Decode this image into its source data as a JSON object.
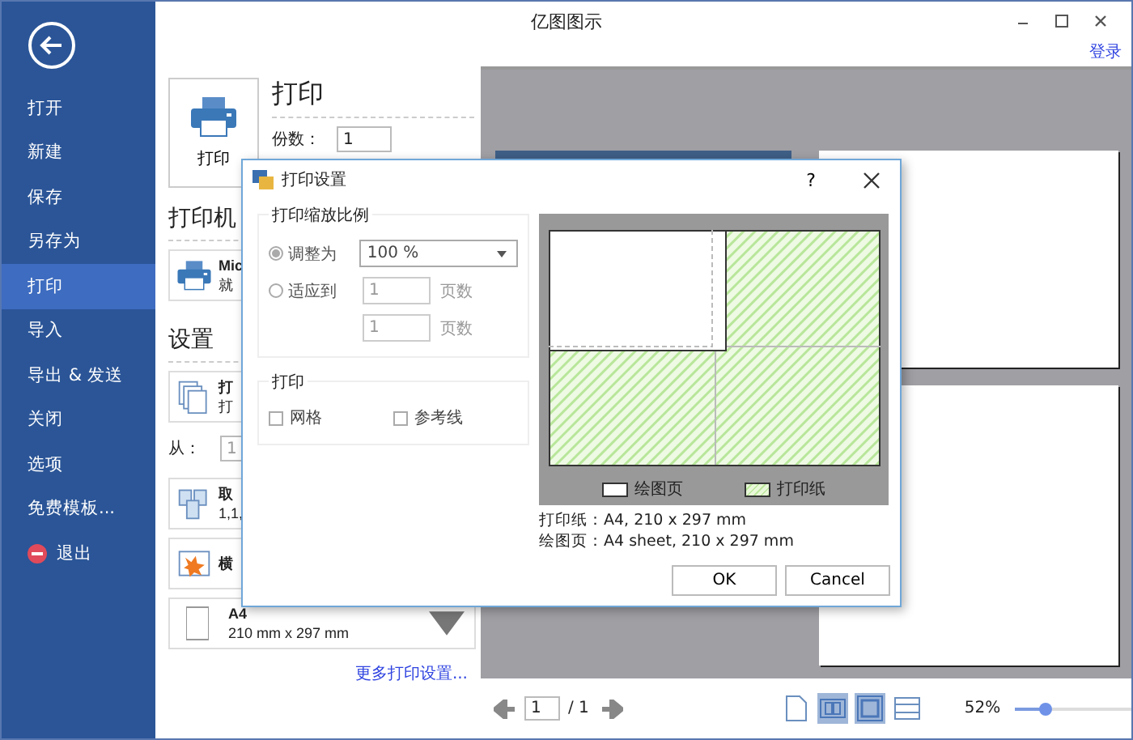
{
  "window": {
    "title": "亿图图示"
  },
  "account_link": "登录",
  "sidebar": {
    "items": [
      {
        "label": "打开",
        "kind": "plain",
        "selected": false
      },
      {
        "label": "新建",
        "kind": "plain",
        "selected": false
      },
      {
        "label": "保存",
        "kind": "plain",
        "selected": false
      },
      {
        "label": "另存为",
        "kind": "plain",
        "selected": false
      },
      {
        "label": "打印",
        "kind": "plain",
        "selected": true
      },
      {
        "label": "导入",
        "kind": "plain",
        "selected": false
      },
      {
        "label": "导出 & 发送",
        "kind": "plain",
        "selected": false
      },
      {
        "label": "关闭",
        "kind": "plain",
        "selected": false
      },
      {
        "label": "选项",
        "kind": "plain",
        "selected": false
      },
      {
        "label": "免费模板...",
        "kind": "plain",
        "selected": false
      },
      {
        "label": "退出",
        "kind": "exit",
        "selected": false
      }
    ]
  },
  "print_panel": {
    "print_button": "打印",
    "heading": "打印",
    "copies_label": "份数：",
    "copies": "1",
    "printer_heading": "打印机",
    "printer_name": "Mic",
    "printer_status": "就",
    "settings_heading": "设置",
    "settings_cards": [
      {
        "kind": "pages",
        "title": "打",
        "subtitle": "打"
      },
      {
        "kind": "range",
        "label": "从：",
        "value": "1"
      },
      {
        "kind": "collate",
        "title": "取",
        "subtitle": "1,1,"
      },
      {
        "kind": "orientation",
        "title": "横"
      },
      {
        "kind": "paper",
        "title": "A4",
        "subtitle": "210 mm x 297 mm"
      }
    ],
    "more_link": "更多打印设置..."
  },
  "dialog": {
    "title": "打印设置",
    "help": "?",
    "scale_group": {
      "title": "打印缩放比例",
      "options": [
        {
          "label": "调整为",
          "selected": true
        },
        {
          "label": "适应到",
          "selected": false
        }
      ],
      "zoom": "100 %",
      "fit_fields": [
        {
          "value": "1",
          "unit": "页数"
        },
        {
          "value": "1",
          "unit": "页数"
        }
      ]
    },
    "print_group": {
      "title": "打印",
      "checkboxes": [
        {
          "label": "网格",
          "checked": false
        },
        {
          "label": "参考线",
          "checked": false
        }
      ]
    },
    "legend": [
      {
        "kind": "drawing",
        "label": "绘图页"
      },
      {
        "kind": "paper",
        "label": "打印纸"
      }
    ],
    "info": [
      "打印纸：A4, 210 x 297 mm",
      "绘图页：A4 sheet, 210 x 297 mm"
    ],
    "buttons": [
      "OK",
      "Cancel"
    ]
  },
  "footer": {
    "page": "1",
    "total": "/ 1",
    "view_buttons": [
      {
        "kind": "single",
        "selected": false
      },
      {
        "kind": "double",
        "selected": true
      },
      {
        "kind": "fit",
        "selected": true
      },
      {
        "kind": "width",
        "selected": false
      }
    ],
    "zoom": "52%",
    "zoom_slider": {
      "level": 0.22
    }
  }
}
